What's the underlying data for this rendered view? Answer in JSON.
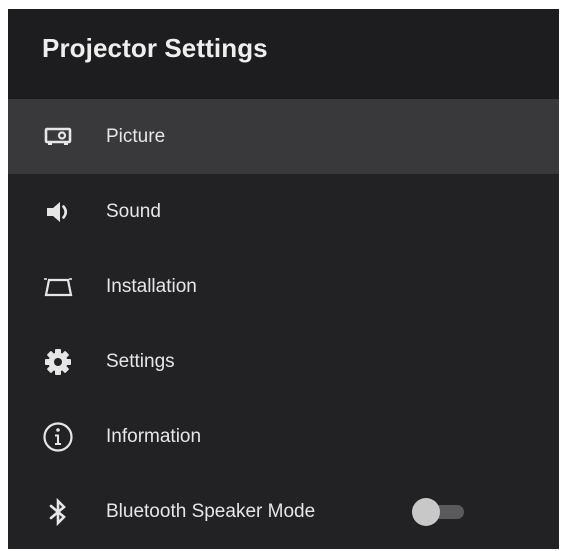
{
  "header": {
    "title": "Projector Settings"
  },
  "menu": {
    "items": [
      {
        "label": "Picture",
        "icon": "projector-icon",
        "selected": true
      },
      {
        "label": "Sound",
        "icon": "speaker-icon"
      },
      {
        "label": "Installation",
        "icon": "keystone-icon"
      },
      {
        "label": "Settings",
        "icon": "gear-icon"
      },
      {
        "label": "Information",
        "icon": "info-icon"
      },
      {
        "label": "Bluetooth Speaker Mode",
        "icon": "bluetooth-icon",
        "toggle_on": false
      }
    ]
  },
  "colors": {
    "background": "#222225",
    "header_background": "#1d1d20",
    "selected_row": "#39393c",
    "text": "#e6e6e6"
  }
}
